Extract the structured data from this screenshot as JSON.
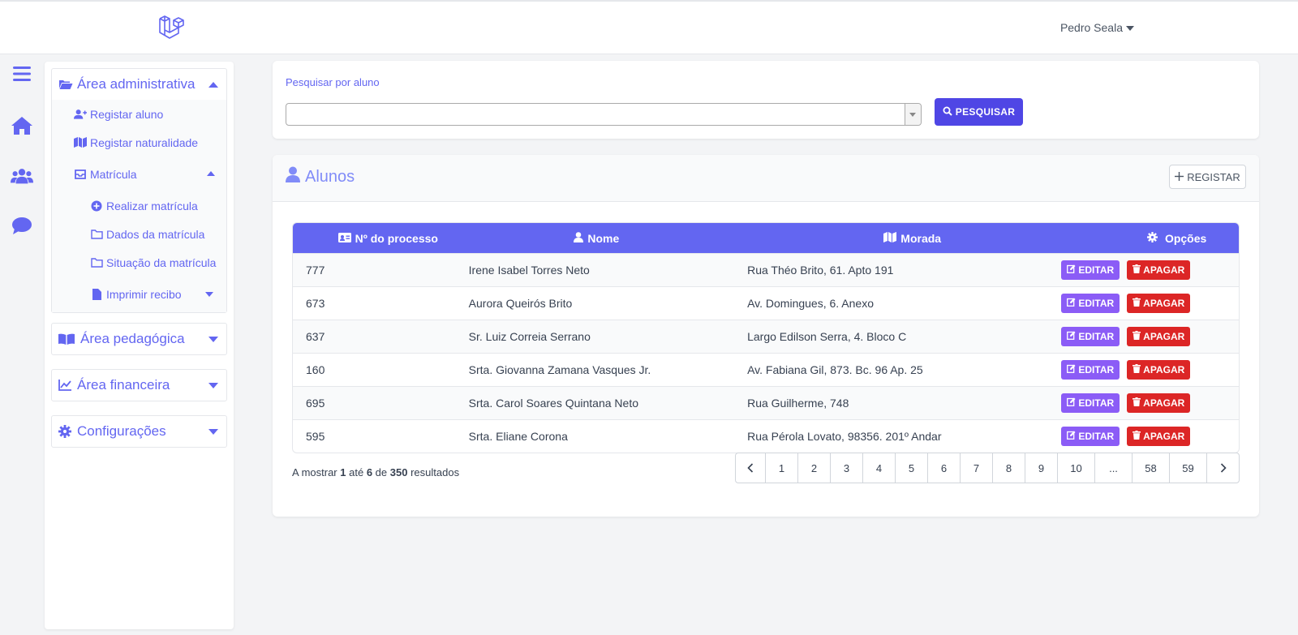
{
  "header": {
    "logo_icon": "laravel-logo-icon",
    "user_name": "Pedro Seala"
  },
  "rail": {
    "icons": [
      "menu-icon",
      "home-icon",
      "users-icon",
      "chat-icon"
    ]
  },
  "sidebar": {
    "admin": {
      "label": "Área administrativa",
      "items": [
        {
          "label": "Registar aluno",
          "icon": "user-plus-icon"
        },
        {
          "label": "Registar naturalidade",
          "icon": "map-icon"
        }
      ],
      "matricula": {
        "label": "Matrícula",
        "items": [
          {
            "label": "Realizar matrícula",
            "icon": "plus-circle-icon"
          },
          {
            "label": "Dados da matrícula",
            "icon": "folder-icon"
          },
          {
            "label": "Situação da matrícula",
            "icon": "folder-icon"
          },
          {
            "label": "Imprimir recibo",
            "icon": "file-icon"
          }
        ]
      }
    },
    "pedagogica": {
      "label": "Área pedagógica"
    },
    "financeira": {
      "label": "Área financeira"
    },
    "config": {
      "label": "Configurações"
    }
  },
  "search": {
    "label": "Pesquisar por aluno",
    "value": "",
    "button_label": "PESQUISAR"
  },
  "students": {
    "title": "Alunos",
    "register_label": "REGISTAR",
    "columns": [
      "Nº do processo",
      "Nome",
      "Morada",
      "Opções"
    ],
    "edit_label": "EDITAR",
    "delete_label": "APAGAR",
    "rows": [
      {
        "processo": "777",
        "nome": "Irene Isabel Torres Neto",
        "morada": "Rua Théo Brito, 61. Apto 191"
      },
      {
        "processo": "673",
        "nome": "Aurora Queirós Brito",
        "morada": "Av. Domingues, 6. Anexo"
      },
      {
        "processo": "637",
        "nome": "Sr. Luiz Correia Serrano",
        "morada": "Largo Edilson Serra, 4. Bloco C"
      },
      {
        "processo": "160",
        "nome": "Srta. Giovanna Zamana Vasques Jr.",
        "morada": "Av. Fabiana Gil, 873. Bc. 96 Ap. 25"
      },
      {
        "processo": "695",
        "nome": "Srta. Carol Soares Quintana Neto",
        "morada": "Rua Guilherme, 748"
      },
      {
        "processo": "595",
        "nome": "Srta. Eliane Corona",
        "morada": "Rua Pérola Lovato, 98356. 201º Andar"
      }
    ]
  },
  "pagination": {
    "text_prefix": "A mostrar",
    "from": "1",
    "text_mid1": "até",
    "to": "6",
    "text_mid2": "de",
    "total": "350",
    "text_suffix": "resultados",
    "pages": [
      "1",
      "2",
      "3",
      "4",
      "5",
      "6",
      "7",
      "8",
      "9",
      "10",
      "...",
      "58",
      "59"
    ]
  },
  "colors": {
    "accent": "#6366f1",
    "primary_button": "#4f46e5",
    "edit": "#8b5cf6",
    "delete": "#dc2626"
  }
}
